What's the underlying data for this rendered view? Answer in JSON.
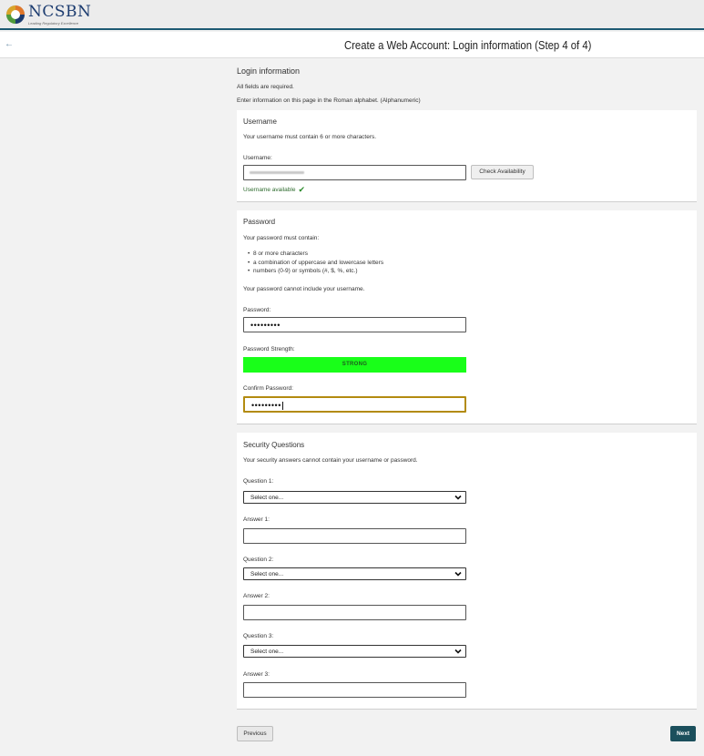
{
  "brand": {
    "name": "NCSBN",
    "tagline": "Leading Regulatory Excellence"
  },
  "header": {
    "back_icon": "arrow-left-icon",
    "title": "Create a Web Account: Login information (Step 4 of 4)"
  },
  "form": {
    "section_title": "Login information",
    "notes": [
      "All fields are required.",
      "Enter information on this page in the Roman alphabet. (Alphanumeric)"
    ]
  },
  "username": {
    "title": "Username",
    "hint": "Your username must contain 6 or more characters.",
    "label": "Username:",
    "check_button": "Check Availability",
    "status": "Username available",
    "status_icon": "checkmark-icon"
  },
  "password": {
    "title": "Password",
    "intro": "Your password must contain:",
    "rules": [
      "8 or more characters",
      "a combination of uppercase and lowercase letters",
      "numbers (0-9) or symbols (#, $, %, etc.)"
    ],
    "note": "Your password cannot include your username.",
    "label": "Password:",
    "value_masked": "•••••••••",
    "strength_label": "Password Strength:",
    "strength_value": "STRONG",
    "confirm_label": "Confirm Password:",
    "confirm_value_masked": "•••••••••"
  },
  "security": {
    "title": "Security Questions",
    "hint": "Your security answers cannot contain your username or password.",
    "questions": [
      {
        "question_label": "Question 1:",
        "selected": "Select one...",
        "answer_label": "Answer 1:"
      },
      {
        "question_label": "Question 2:",
        "selected": "Select one...",
        "answer_label": "Answer 2:"
      },
      {
        "question_label": "Question 3:",
        "selected": "Select one...",
        "answer_label": "Answer 3:"
      }
    ]
  },
  "footer": {
    "previous_label": "Previous",
    "next_label": "Next"
  },
  "colors": {
    "brand_navy": "#1b3b6f",
    "header_rule": "#1d5a73",
    "strength_green": "#19ff19",
    "next_button": "#1b4f5c",
    "focus_border": "#b38b10"
  }
}
